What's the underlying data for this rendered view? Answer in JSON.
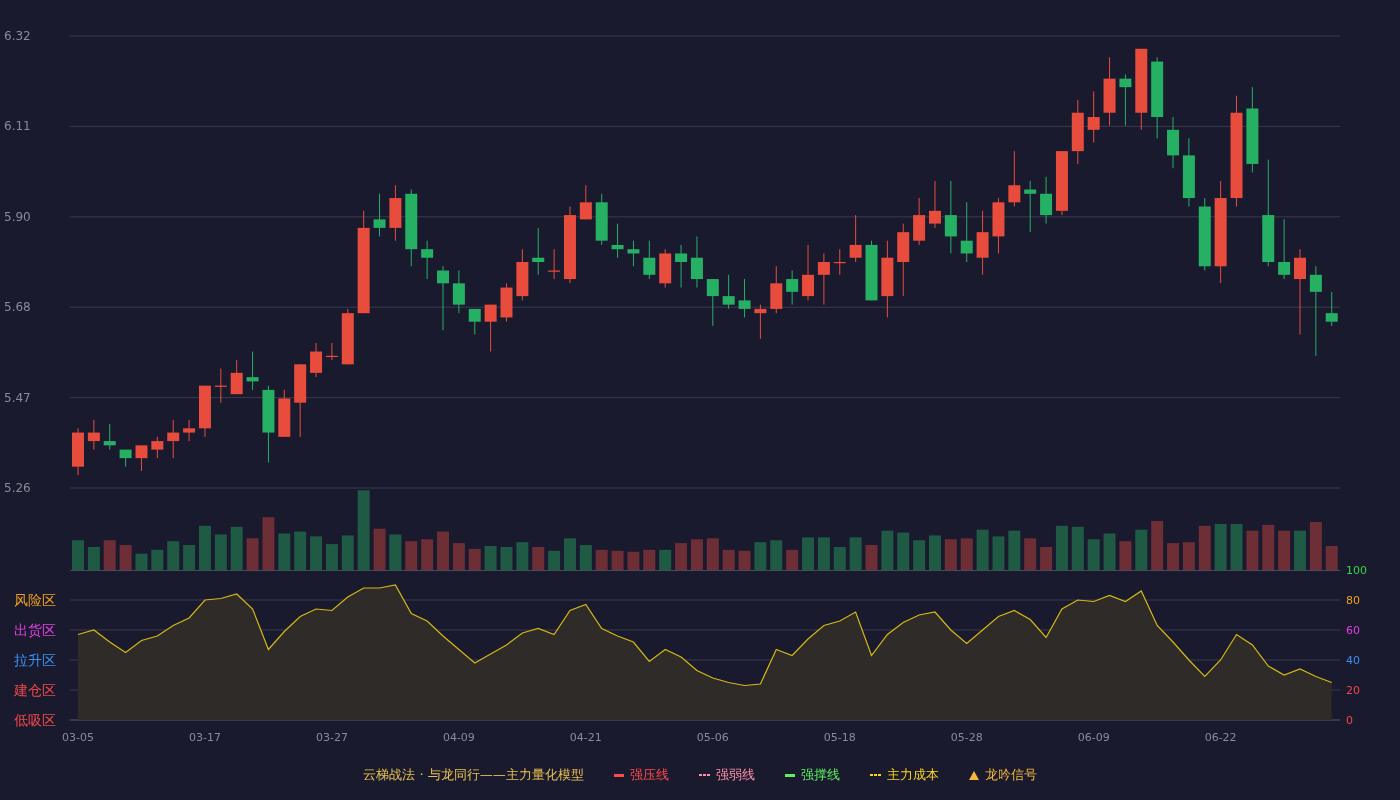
{
  "price_chart": {
    "chart_data": {
      "type": "candlestick",
      "grid": true,
      "ylim": [
        5.26,
        6.32
      ],
      "yticks": [
        {
          "value": 6.32,
          "label": "6.32"
        },
        {
          "value": 6.108,
          "label": "6.11"
        },
        {
          "value": 5.896,
          "label": "5.90"
        },
        {
          "value": 5.684,
          "label": "5.68"
        },
        {
          "value": 5.472,
          "label": "5.47"
        },
        {
          "value": 5.26,
          "label": "5.26"
        }
      ],
      "categories": [
        null,
        null,
        null,
        null,
        null,
        null,
        null,
        null,
        null,
        null,
        null,
        null,
        null,
        null,
        null,
        null,
        null,
        null,
        null,
        null,
        null,
        null,
        null,
        null,
        null,
        null,
        null,
        null,
        null,
        null,
        null,
        null,
        null,
        null,
        null,
        null,
        null,
        null,
        null,
        null,
        null,
        null,
        null,
        null,
        null,
        null,
        null,
        null,
        null,
        null,
        null,
        null,
        null,
        null,
        null,
        null,
        null,
        null,
        null,
        null,
        null,
        null,
        null,
        null,
        null,
        null,
        null,
        null,
        null,
        null,
        null,
        null,
        null,
        null,
        null,
        null,
        null,
        null,
        null,
        null
      ],
      "ohlc": [
        [
          5.31,
          5.4,
          5.29,
          5.39
        ],
        [
          5.37,
          5.42,
          5.35,
          5.39
        ],
        [
          5.37,
          5.41,
          5.35,
          5.36
        ],
        [
          5.35,
          5.35,
          5.31,
          5.33
        ],
        [
          5.33,
          5.36,
          5.3,
          5.36
        ],
        [
          5.35,
          5.38,
          5.33,
          5.37
        ],
        [
          5.37,
          5.42,
          5.33,
          5.39
        ],
        [
          5.39,
          5.42,
          5.37,
          5.4
        ],
        [
          5.4,
          5.5,
          5.38,
          5.5
        ],
        [
          5.5,
          5.54,
          5.46,
          5.5
        ],
        [
          5.48,
          5.56,
          5.48,
          5.53
        ],
        [
          5.52,
          5.58,
          5.49,
          5.51
        ],
        [
          5.49,
          5.5,
          5.32,
          5.39
        ],
        [
          5.38,
          5.49,
          5.38,
          5.47
        ],
        [
          5.46,
          5.55,
          5.38,
          5.55
        ],
        [
          5.53,
          5.6,
          5.52,
          5.58
        ],
        [
          5.57,
          5.6,
          5.56,
          5.57
        ],
        [
          5.55,
          5.68,
          5.55,
          5.67
        ],
        [
          5.67,
          5.91,
          5.67,
          5.87
        ],
        [
          5.89,
          5.95,
          5.85,
          5.87
        ],
        [
          5.87,
          5.97,
          5.84,
          5.94
        ],
        [
          5.95,
          5.96,
          5.78,
          5.82
        ],
        [
          5.82,
          5.84,
          5.75,
          5.8
        ],
        [
          5.77,
          5.78,
          5.63,
          5.74
        ],
        [
          5.74,
          5.77,
          5.67,
          5.69
        ],
        [
          5.68,
          5.68,
          5.62,
          5.65
        ],
        [
          5.65,
          5.69,
          5.58,
          5.69
        ],
        [
          5.66,
          5.74,
          5.65,
          5.73
        ],
        [
          5.71,
          5.82,
          5.7,
          5.79
        ],
        [
          5.8,
          5.87,
          5.76,
          5.79
        ],
        [
          5.77,
          5.82,
          5.75,
          5.77
        ],
        [
          5.75,
          5.92,
          5.74,
          5.9
        ],
        [
          5.89,
          5.97,
          5.89,
          5.93
        ],
        [
          5.93,
          5.95,
          5.83,
          5.84
        ],
        [
          5.83,
          5.88,
          5.8,
          5.82
        ],
        [
          5.82,
          5.84,
          5.78,
          5.81
        ],
        [
          5.8,
          5.84,
          5.75,
          5.76
        ],
        [
          5.74,
          5.82,
          5.73,
          5.81
        ],
        [
          5.81,
          5.83,
          5.73,
          5.79
        ],
        [
          5.8,
          5.85,
          5.73,
          5.75
        ],
        [
          5.75,
          5.75,
          5.64,
          5.71
        ],
        [
          5.71,
          5.76,
          5.68,
          5.69
        ],
        [
          5.7,
          5.75,
          5.66,
          5.68
        ],
        [
          5.67,
          5.69,
          5.61,
          5.68
        ],
        [
          5.68,
          5.78,
          5.67,
          5.74
        ],
        [
          5.75,
          5.77,
          5.69,
          5.72
        ],
        [
          5.71,
          5.83,
          5.7,
          5.76
        ],
        [
          5.76,
          5.81,
          5.69,
          5.79
        ],
        [
          5.79,
          5.82,
          5.76,
          5.79
        ],
        [
          5.8,
          5.9,
          5.79,
          5.83
        ],
        [
          5.83,
          5.84,
          5.7,
          5.7
        ],
        [
          5.71,
          5.84,
          5.66,
          5.8
        ],
        [
          5.79,
          5.88,
          5.71,
          5.86
        ],
        [
          5.84,
          5.94,
          5.83,
          5.9
        ],
        [
          5.88,
          5.98,
          5.87,
          5.91
        ],
        [
          5.9,
          5.98,
          5.81,
          5.85
        ],
        [
          5.84,
          5.93,
          5.79,
          5.81
        ],
        [
          5.8,
          5.91,
          5.76,
          5.86
        ],
        [
          5.85,
          5.94,
          5.81,
          5.93
        ],
        [
          5.93,
          6.05,
          5.92,
          5.97
        ],
        [
          5.96,
          5.98,
          5.86,
          5.95
        ],
        [
          5.95,
          5.99,
          5.88,
          5.9
        ],
        [
          5.91,
          6.05,
          5.9,
          6.05
        ],
        [
          6.05,
          6.17,
          6.02,
          6.14
        ],
        [
          6.1,
          6.19,
          6.07,
          6.13
        ],
        [
          6.14,
          6.27,
          6.11,
          6.22
        ],
        [
          6.22,
          6.23,
          6.11,
          6.2
        ],
        [
          6.14,
          6.29,
          6.1,
          6.29
        ],
        [
          6.26,
          6.27,
          6.08,
          6.13
        ],
        [
          6.1,
          6.13,
          6.01,
          6.04
        ],
        [
          6.04,
          6.08,
          5.92,
          5.94
        ],
        [
          5.92,
          5.94,
          5.77,
          5.78
        ],
        [
          5.78,
          5.98,
          5.74,
          5.94
        ],
        [
          5.94,
          6.18,
          5.92,
          6.14
        ],
        [
          6.15,
          6.2,
          6.0,
          6.02
        ],
        [
          5.9,
          6.03,
          5.78,
          5.79
        ],
        [
          5.79,
          5.89,
          5.75,
          5.76
        ],
        [
          5.75,
          5.82,
          5.62,
          5.8
        ],
        [
          5.76,
          5.78,
          5.57,
          5.72
        ],
        [
          5.67,
          5.72,
          5.64,
          5.65
        ]
      ]
    }
  },
  "oscillator": {
    "zones": [
      {
        "label": "风险区",
        "color": "#f0a020"
      },
      {
        "label": "出货区",
        "color": "#e040e0"
      },
      {
        "label": "拉升区",
        "color": "#3d8ef0"
      },
      {
        "label": "建仓区",
        "color": "#f04848"
      },
      {
        "label": "低吸区",
        "color": "#f04848"
      }
    ],
    "right_ticks": [
      {
        "label": "100",
        "color": "#3ad44a"
      },
      {
        "label": "80",
        "color": "#f0a020"
      },
      {
        "label": "60",
        "color": "#e040e0"
      },
      {
        "label": "40",
        "color": "#3d8ef0"
      },
      {
        "label": "20",
        "color": "#f04848"
      },
      {
        "label": "0",
        "color": "#f04848"
      }
    ],
    "chart_data": {
      "type": "area",
      "grid": true,
      "ylim": [
        0,
        100
      ],
      "yticks": [
        100,
        80,
        60,
        40,
        20,
        0
      ],
      "categories": [
        "03-05",
        null,
        null,
        null,
        null,
        null,
        null,
        null,
        "03-17",
        null,
        null,
        null,
        null,
        null,
        null,
        null,
        "03-27",
        null,
        null,
        null,
        null,
        null,
        null,
        null,
        "04-09",
        null,
        null,
        null,
        null,
        null,
        null,
        null,
        "04-21",
        null,
        null,
        null,
        null,
        null,
        null,
        null,
        "05-06",
        null,
        null,
        null,
        null,
        null,
        null,
        null,
        "05-18",
        null,
        null,
        null,
        null,
        null,
        null,
        null,
        "05-28",
        null,
        null,
        null,
        null,
        null,
        null,
        null,
        "06-09",
        null,
        null,
        null,
        null,
        null,
        null,
        null,
        "06-22",
        null,
        null,
        null,
        null,
        null,
        null,
        null
      ],
      "values": [
        57,
        60,
        52,
        45,
        53,
        56,
        63,
        68,
        80,
        81,
        84,
        74,
        47,
        59,
        69,
        74,
        73,
        82,
        88,
        88,
        90,
        71,
        66,
        56,
        47,
        38,
        44,
        50,
        58,
        61,
        57,
        73,
        77,
        61,
        56,
        52,
        39,
        47,
        42,
        33,
        28,
        25,
        23,
        24,
        47,
        43,
        54,
        63,
        66,
        72,
        43,
        57,
        65,
        70,
        72,
        60,
        51,
        60,
        69,
        73,
        67,
        55,
        74,
        80,
        79,
        83,
        79,
        86,
        63,
        52,
        40,
        29,
        40,
        57,
        50,
        36,
        30,
        34,
        29,
        25
      ]
    }
  },
  "legend": {
    "title": "云梯战法 · 与龙同行——主力量化模型",
    "items": [
      {
        "label": "强压线",
        "kind": "line",
        "color": "#ff4a4a"
      },
      {
        "label": "强弱线",
        "kind": "dashed",
        "color": "#ff8fa8"
      },
      {
        "label": "强撑线",
        "kind": "line",
        "color": "#5cf05c"
      },
      {
        "label": "主力成本",
        "kind": "dashed",
        "color": "#ffd21f"
      },
      {
        "label": "龙吟信号",
        "kind": "triangle",
        "color": "#f5b83d"
      }
    ]
  }
}
